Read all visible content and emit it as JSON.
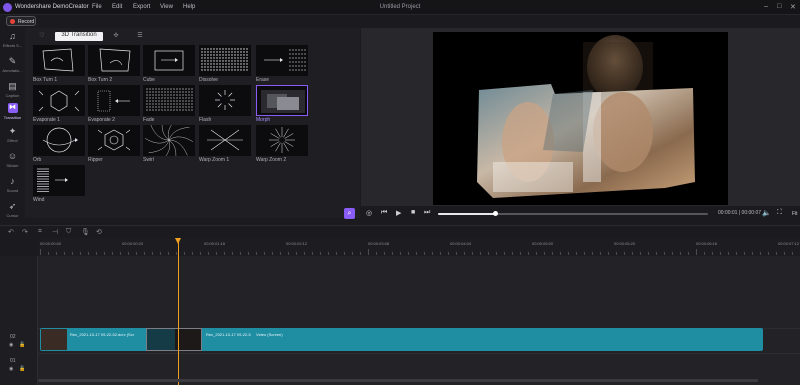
{
  "titlebar": {
    "app_name": "Wondershare DemoCreator",
    "menus": [
      "File",
      "Edit",
      "Export",
      "View",
      "Help"
    ],
    "project_title": "Untitled Project"
  },
  "record": {
    "label": "Record"
  },
  "sidebar": {
    "items": [
      {
        "label": "Effects S...",
        "icon": "effects-icon",
        "glyph": "♫"
      },
      {
        "label": "Annotatio...",
        "icon": "annotation-icon",
        "glyph": "✎"
      },
      {
        "label": "Caption",
        "icon": "caption-icon",
        "glyph": "▤"
      },
      {
        "label": "Transition",
        "icon": "transition-icon",
        "glyph": "⧓"
      },
      {
        "label": "Effect",
        "icon": "effect-icon",
        "glyph": "✦"
      },
      {
        "label": "Sticker",
        "icon": "sticker-icon",
        "glyph": "☺"
      },
      {
        "label": "Sound",
        "icon": "sound-icon",
        "glyph": "♪"
      },
      {
        "label": "Cursor",
        "icon": "cursor-icon",
        "glyph": "➶"
      }
    ],
    "active_index": 3
  },
  "library": {
    "tabs": [
      {
        "label": "♡",
        "icon": "favorite-icon"
      },
      {
        "label": "3D Transition",
        "icon": ""
      },
      {
        "label": "✣",
        "icon": "transition-type-icon"
      },
      {
        "label": "☰",
        "icon": "list-icon"
      }
    ],
    "active_tab": 1,
    "tiles": [
      {
        "name": "Box Turn 1",
        "kind": "boxturn"
      },
      {
        "name": "Box Turn 2",
        "kind": "boxturn2"
      },
      {
        "name": "Cube",
        "kind": "cube"
      },
      {
        "name": "Dissolve",
        "kind": "dots"
      },
      {
        "name": "Erase",
        "kind": "erase"
      },
      {
        "name": "Evaporate 1",
        "kind": "evap1"
      },
      {
        "name": "Evaporate 2",
        "kind": "evap2"
      },
      {
        "name": "Fade",
        "kind": "fade"
      },
      {
        "name": "Flash",
        "kind": "flash"
      },
      {
        "name": "Morph",
        "kind": "morph"
      },
      {
        "name": "Orb",
        "kind": "orb"
      },
      {
        "name": "Ripper",
        "kind": "ripper"
      },
      {
        "name": "Swirl",
        "kind": "swirl"
      },
      {
        "name": "Warp Zoom 1",
        "kind": "warp1"
      },
      {
        "name": "Warp Zoom 2",
        "kind": "warp2"
      },
      {
        "name": "Wind",
        "kind": "wind"
      }
    ],
    "selected_index": 9
  },
  "preview": {
    "timecode": "00:00:01 | 00:00:07",
    "progress": 0.21,
    "fit_label": "Fit"
  },
  "timeline": {
    "ruler_labels": [
      "00:00:00:00",
      "00:00:00:20",
      "00:00:01:16",
      "00:00:02:12",
      "00:00:03:08",
      "00:00:04:04",
      "00:00:05:00",
      "00:00:05:20",
      "00:00:06:16",
      "00:00:07:12"
    ],
    "clip": {
      "label_1": "Rec_2021-10-17 09-22-52.dcrc (Scr",
      "label_2": "Rec_2021-10-17 09-22-5",
      "label_3": "Video (Screen)"
    },
    "track_numbers": [
      "02",
      "01"
    ]
  },
  "colors": {
    "accent": "#8a5cf6",
    "clip": "#1f8ea3",
    "playhead": "#f0a020"
  }
}
